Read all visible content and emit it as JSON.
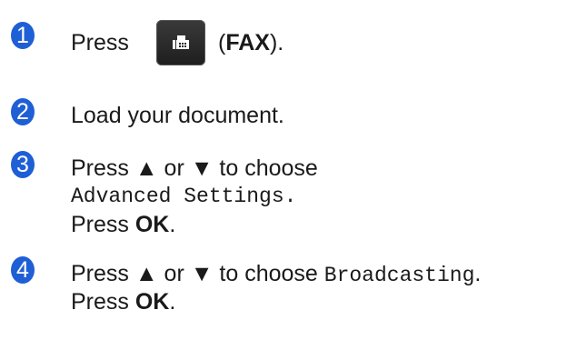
{
  "steps": [
    {
      "number": "1",
      "text_before": "Press",
      "button_icon": "fax-icon",
      "text_open": "(",
      "bold": "FAX",
      "text_close": ")."
    },
    {
      "number": "2",
      "text": "Load your document."
    },
    {
      "number": "3",
      "line1": "Press ▲ or ▼ to choose",
      "line2_mono": "Advanced Settings.",
      "line3_prefix": "Press ",
      "line3_bold": "OK",
      "line3_suffix": "."
    },
    {
      "number": "4",
      "line1_prefix": "Press ▲ or ▼ to choose ",
      "line1_mono": "Broadcasting",
      "line1_suffix": ".",
      "line2_prefix": "Press ",
      "line2_bold": "OK",
      "line2_suffix": "."
    }
  ],
  "colors": {
    "badge": "#1f5fd6",
    "button": "#2b2b2b"
  }
}
